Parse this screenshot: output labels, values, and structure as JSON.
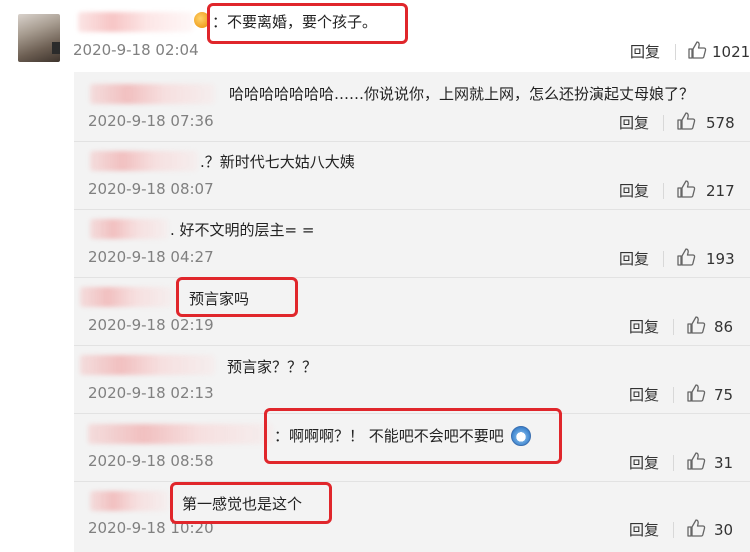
{
  "colors": {
    "highlight": "#e0262b",
    "subpanel": "#f3f3f3",
    "timestamp": "#808080"
  },
  "main_comment": {
    "text": "：不要离婚，要个孩子。",
    "time": "2020-9-18 02:04",
    "reply_label": "回复",
    "likes": "1021"
  },
  "replies": [
    {
      "text": "哈哈哈哈哈哈哈……你说说你，上网就上网，怎么还扮演起丈母娘了？",
      "time": "2020-9-18 07:36",
      "reply_label": "回复",
      "likes": "578"
    },
    {
      "text": ".？新时代七大姑八大姨",
      "time": "2020-9-18 08:07",
      "reply_label": "回复",
      "likes": "217"
    },
    {
      "text": ". 好不文明的层主= =",
      "time": "2020-9-18 04:27",
      "reply_label": "回复",
      "likes": "193"
    },
    {
      "text": "预言家吗",
      "time": "2020-9-18 02:19",
      "reply_label": "回复",
      "likes": "86"
    },
    {
      "text": "预言家？？？",
      "time": "2020-9-18 02:13",
      "reply_label": "回复",
      "likes": "75"
    },
    {
      "text": "：啊啊啊？！ 不能吧不会吧不要吧",
      "time": "2020-9-18 08:58",
      "reply_label": "回复",
      "likes": "31"
    },
    {
      "text": "第一感觉也是这个",
      "time": "2020-9-18 10:20",
      "reply_label": "回复",
      "likes": "30"
    }
  ]
}
